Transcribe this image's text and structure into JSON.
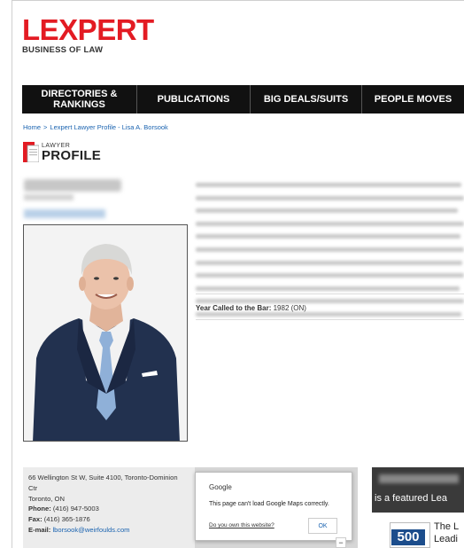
{
  "brand": {
    "logo_text": "LEXPERT",
    "tagline": "BUSINESS OF LAW",
    "accent_color": "#e31b23"
  },
  "nav": {
    "items": [
      {
        "label": "DIRECTORIES & RANKINGS"
      },
      {
        "label": "PUBLICATIONS"
      },
      {
        "label": "BIG DEALS/SUITS"
      },
      {
        "label": "PEOPLE MOVES"
      }
    ]
  },
  "breadcrumb": {
    "home": "Home",
    "separator": ">",
    "current": "Lexpert Lawyer Profile - Lisa A. Borsook"
  },
  "badge": {
    "small": "LAWYER",
    "big": "PROFILE"
  },
  "profile": {
    "year_label": "Year Called to the Bar:",
    "year_value": "1982 (ON)"
  },
  "contact": {
    "address1": "66 Wellington St W, Suite 4100, Toronto-Dominion Ctr",
    "city": "Toronto, ON",
    "phone_label": "Phone:",
    "phone": "(416) 947-5003",
    "fax_label": "Fax:",
    "fax": "(416) 365-1876",
    "email_label": "E-mail:",
    "email": "lborsook@weirfoulds.com"
  },
  "map_dialog": {
    "title": "Google",
    "message": "This page can't load Google Maps correctly.",
    "link": "Do you own this website?",
    "ok": "OK",
    "zoom_out": "−"
  },
  "featured": {
    "text": "is a featured Lea",
    "badge_number": "500",
    "side_text_1": "The L",
    "side_text_2": "Leadi"
  }
}
